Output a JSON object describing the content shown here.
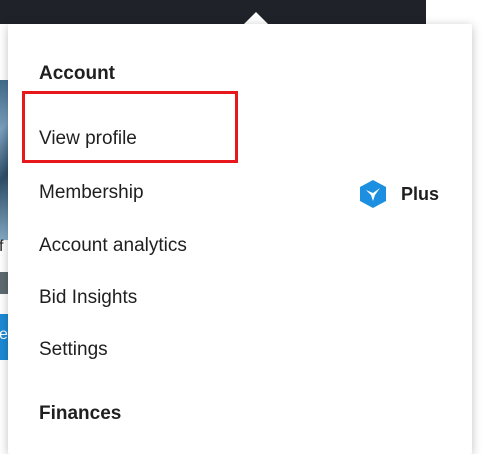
{
  "menu": {
    "account_heading": "Account",
    "items": [
      {
        "label": "View profile"
      },
      {
        "label": "Membership"
      },
      {
        "label": "Account analytics"
      },
      {
        "label": "Bid Insights"
      },
      {
        "label": "Settings"
      }
    ],
    "finances_heading": "Finances"
  },
  "membership_badge": {
    "label": "Plus",
    "icon": "bird-badge-icon",
    "color": "#1d8fe0"
  },
  "background": {
    "partial_letters": [
      "f",
      "e"
    ]
  },
  "colors": {
    "highlight": "#e8171c",
    "topbar": "#1f2329"
  }
}
